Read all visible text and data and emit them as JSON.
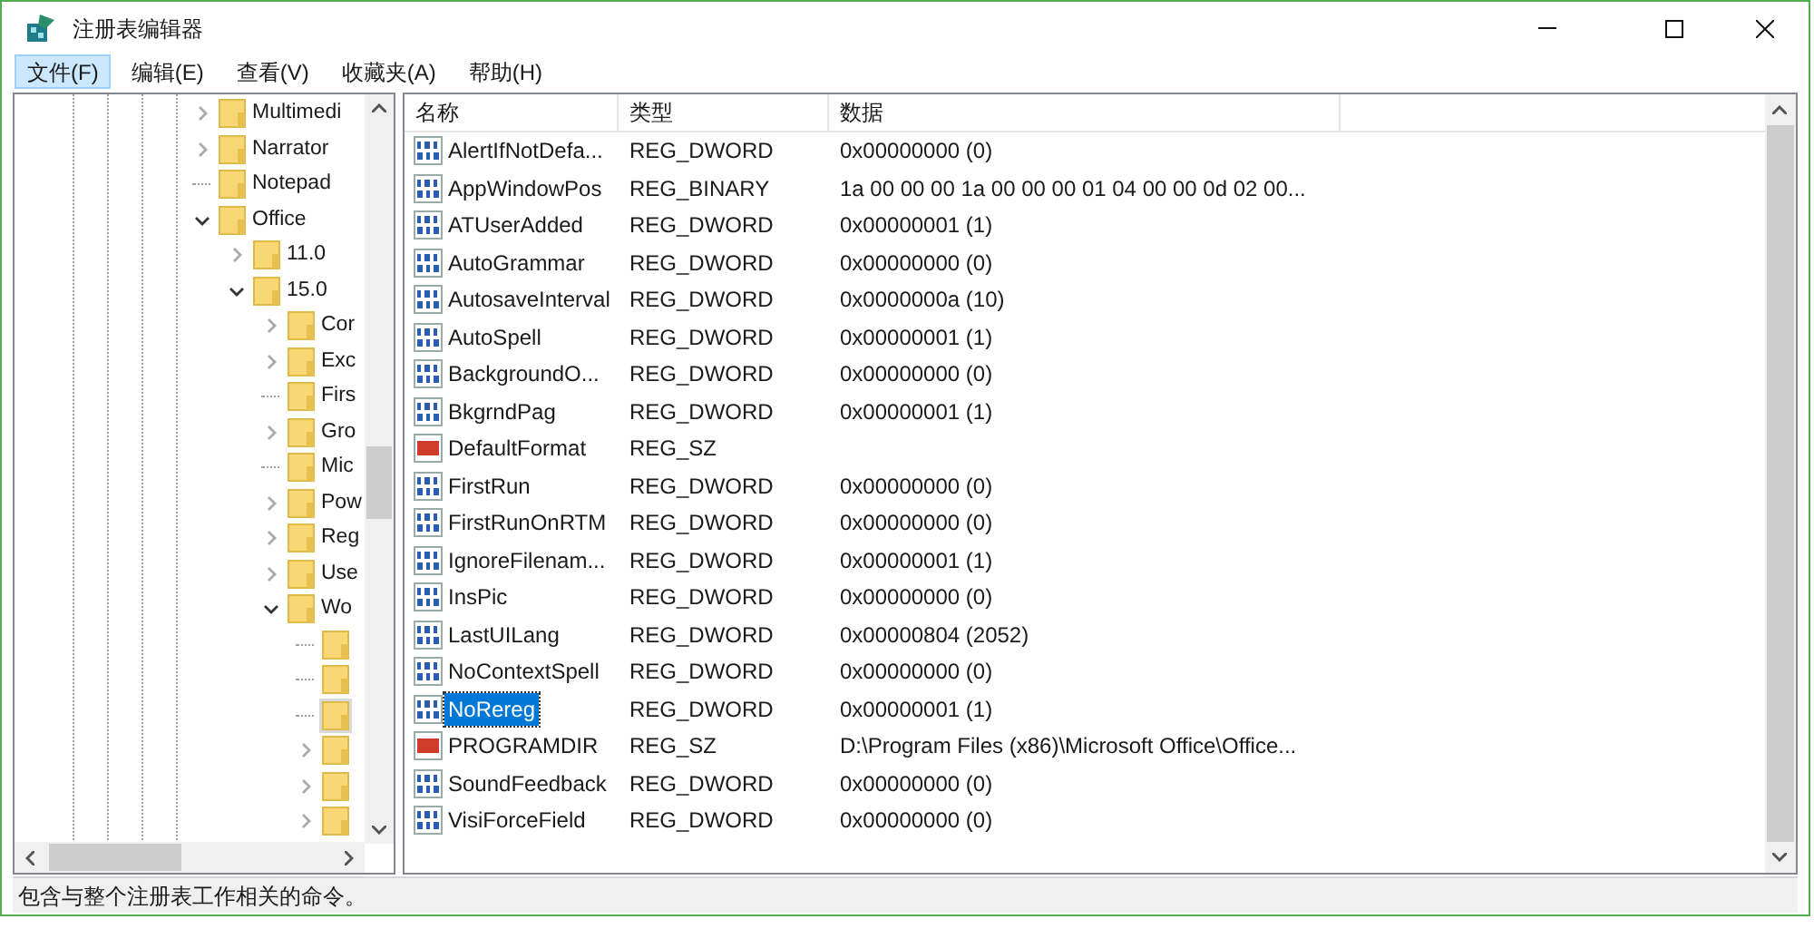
{
  "window": {
    "title": "注册表编辑器"
  },
  "menu": [
    {
      "label": "文件(F)",
      "selected": true
    },
    {
      "label": "编辑(E)",
      "selected": false
    },
    {
      "label": "查看(V)",
      "selected": false
    },
    {
      "label": "收藏夹(A)",
      "selected": false
    },
    {
      "label": "帮助(H)",
      "selected": false
    }
  ],
  "tree": [
    {
      "label": "Multimedi",
      "has_children": true,
      "expanded": false,
      "selected": false
    },
    {
      "label": "Narrator",
      "has_children": true,
      "expanded": false,
      "selected": false
    },
    {
      "label": "Notepad",
      "has_children": false,
      "selected": false
    },
    {
      "label": "Office",
      "has_children": true,
      "expanded": true,
      "selected": false,
      "children": [
        {
          "label": "11.0",
          "has_children": true,
          "expanded": false,
          "selected": false
        },
        {
          "label": "15.0",
          "has_children": true,
          "expanded": true,
          "selected": false,
          "children": [
            {
              "label": "Cor",
              "has_children": true,
              "expanded": false,
              "selected": false
            },
            {
              "label": "Exc",
              "has_children": true,
              "expanded": false,
              "selected": false
            },
            {
              "label": "Firs",
              "has_children": false,
              "selected": false
            },
            {
              "label": "Gro",
              "has_children": true,
              "expanded": false,
              "selected": false
            },
            {
              "label": "Mic",
              "has_children": false,
              "selected": false
            },
            {
              "label": "Pow",
              "has_children": true,
              "expanded": false,
              "selected": false
            },
            {
              "label": "Reg",
              "has_children": true,
              "expanded": false,
              "selected": false
            },
            {
              "label": "Use",
              "has_children": true,
              "expanded": false,
              "selected": false
            },
            {
              "label": "Wo",
              "has_children": true,
              "expanded": true,
              "selected": false,
              "children": [
                {
                  "has_children": false,
                  "selected": false
                },
                {
                  "has_children": false,
                  "selected": false
                },
                {
                  "has_children": false,
                  "selected": true
                },
                {
                  "has_children": true,
                  "expanded": false,
                  "selected": false
                },
                {
                  "has_children": true,
                  "expanded": false,
                  "selected": false
                },
                {
                  "has_children": true,
                  "expanded": false,
                  "selected": false
                }
              ]
            }
          ]
        }
      ]
    }
  ],
  "table": {
    "columns": [
      "名称",
      "类型",
      "数据"
    ],
    "rows": [
      {
        "kind": "binary",
        "name": "AlertIfNotDefa...",
        "type": "REG_DWORD",
        "data": "0x00000000 (0)",
        "selected": false
      },
      {
        "kind": "binary",
        "name": "AppWindowPos",
        "type": "REG_BINARY",
        "data": "1a 00 00 00 1a 00 00 00 01 04 00 00 0d 02 00...",
        "selected": false
      },
      {
        "kind": "binary",
        "name": "ATUserAdded",
        "type": "REG_DWORD",
        "data": "0x00000001 (1)",
        "selected": false
      },
      {
        "kind": "binary",
        "name": "AutoGrammar",
        "type": "REG_DWORD",
        "data": "0x00000000 (0)",
        "selected": false
      },
      {
        "kind": "binary",
        "name": "AutosaveInterval",
        "type": "REG_DWORD",
        "data": "0x0000000a (10)",
        "selected": false
      },
      {
        "kind": "binary",
        "name": "AutoSpell",
        "type": "REG_DWORD",
        "data": "0x00000001 (1)",
        "selected": false
      },
      {
        "kind": "binary",
        "name": "BackgroundO...",
        "type": "REG_DWORD",
        "data": "0x00000000 (0)",
        "selected": false
      },
      {
        "kind": "binary",
        "name": "BkgrndPag",
        "type": "REG_DWORD",
        "data": "0x00000001 (1)",
        "selected": false
      },
      {
        "kind": "string",
        "name": "DefaultFormat",
        "type": "REG_SZ",
        "selected": false
      },
      {
        "kind": "binary",
        "name": "FirstRun",
        "type": "REG_DWORD",
        "data": "0x00000000 (0)",
        "selected": false
      },
      {
        "kind": "binary",
        "name": "FirstRunOnRTM",
        "type": "REG_DWORD",
        "data": "0x00000000 (0)",
        "selected": false
      },
      {
        "kind": "binary",
        "name": "IgnoreFilenam...",
        "type": "REG_DWORD",
        "data": "0x00000001 (1)",
        "selected": false
      },
      {
        "kind": "binary",
        "name": "InsPic",
        "type": "REG_DWORD",
        "data": "0x00000000 (0)",
        "selected": false
      },
      {
        "kind": "binary",
        "name": "LastUILang",
        "type": "REG_DWORD",
        "data": "0x00000804 (2052)",
        "selected": false
      },
      {
        "kind": "binary",
        "name": "NoContextSpell",
        "type": "REG_DWORD",
        "data": "0x00000000 (0)",
        "selected": false
      },
      {
        "kind": "binary",
        "name": "NoRereg",
        "type": "REG_DWORD",
        "data": "0x00000001 (1)",
        "selected": true
      },
      {
        "kind": "string",
        "name": "PROGRAMDIR",
        "type": "REG_SZ",
        "data": "D:\\Program Files (x86)\\Microsoft Office\\Office...",
        "selected": false
      },
      {
        "kind": "binary",
        "name": "SoundFeedback",
        "type": "REG_DWORD",
        "data": "0x00000000 (0)",
        "selected": false
      },
      {
        "kind": "binary",
        "name": "VisiForceField",
        "type": "REG_DWORD",
        "data": "0x00000000 (0)",
        "selected": false
      }
    ]
  },
  "status_bar": "包含与整个注册表工作相关的命令。"
}
